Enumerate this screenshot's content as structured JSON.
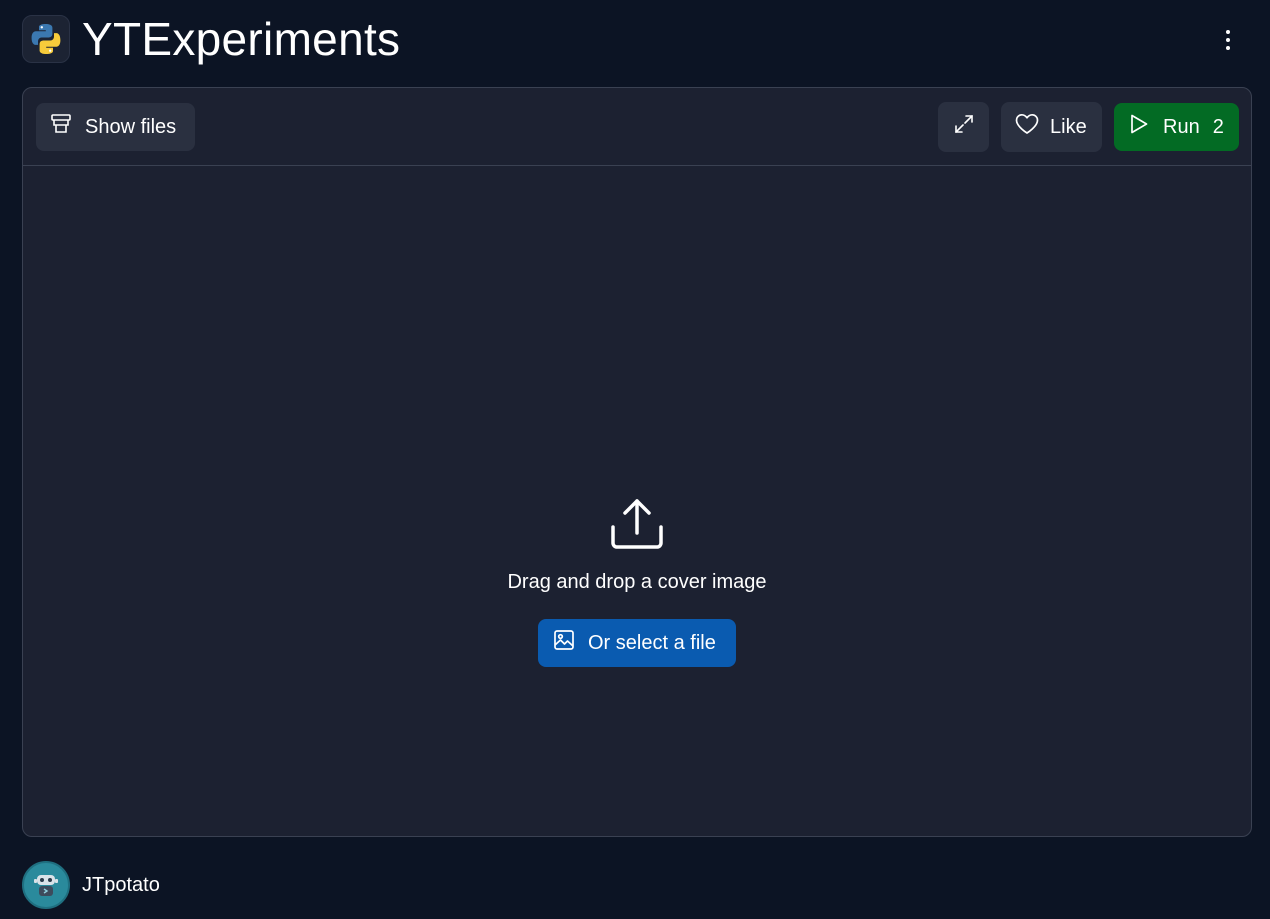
{
  "header": {
    "title": "YTExperiments",
    "logo_icon": "python-logo-icon",
    "menu_icon": "kebab-menu-icon"
  },
  "toolbar": {
    "show_files_label": "Show files",
    "show_files_icon": "files-icon",
    "expand_icon": "expand-icon",
    "like_label": "Like",
    "like_icon": "heart-icon",
    "run_label": "Run",
    "run_count": "2",
    "run_icon": "play-icon"
  },
  "dropzone": {
    "upload_icon": "upload-icon",
    "text": "Drag and drop a cover image",
    "select_label": "Or select a file",
    "select_icon": "image-icon"
  },
  "footer": {
    "username": "JTpotato",
    "avatar_icon": "robot-avatar-icon"
  },
  "colors": {
    "page_bg": "#0c1424",
    "panel_bg": "#1c2131",
    "button_bg": "#2a3040",
    "run_green": "#036b24",
    "select_blue": "#0a5bb0"
  }
}
